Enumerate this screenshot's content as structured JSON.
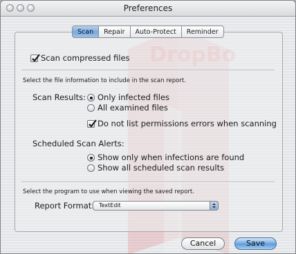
{
  "window": {
    "title": "Preferences"
  },
  "tabs": [
    {
      "label": "Scan",
      "selected": true
    },
    {
      "label": "Repair",
      "selected": false
    },
    {
      "label": "Auto-Protect",
      "selected": false
    },
    {
      "label": "Reminder",
      "selected": false
    }
  ],
  "scan": {
    "compressed_label": "Scan compressed files",
    "compressed_checked": true,
    "info_instruction": "Select the file information to include in the scan report.",
    "results_label": "Scan Results:",
    "results_options": [
      {
        "label": "Only infected files",
        "selected": true
      },
      {
        "label": "All examined files",
        "selected": false
      }
    ],
    "permissions_label": "Do not list permissions errors when scanning",
    "permissions_checked": true,
    "alerts_label": "Scheduled Scan Alerts:",
    "alerts_options": [
      {
        "label": "Show only when infections are found",
        "selected": true
      },
      {
        "label": "Show all scheduled scan results",
        "selected": false
      }
    ],
    "program_instruction": "Select the program to use when viewing the saved report.",
    "report_label": "Report Format:",
    "report_value": "TextEdit"
  },
  "buttons": {
    "cancel": "Cancel",
    "save": "Save"
  },
  "colors": {
    "accent": "#6fa6dd",
    "watermark": "#e26a6a"
  }
}
